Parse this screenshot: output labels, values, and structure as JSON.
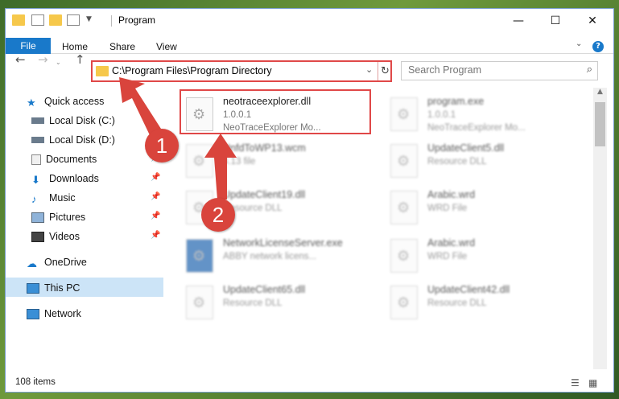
{
  "window": {
    "title": "Program"
  },
  "ribbon": {
    "file": "File",
    "home": "Home",
    "share": "Share",
    "view": "View",
    "help": "?"
  },
  "nav": {
    "back": "←",
    "forward": "→",
    "up": "↑"
  },
  "address": {
    "path": "C:\\Program Files\\Program Directory"
  },
  "search": {
    "placeholder": "Search Program"
  },
  "sidebar": {
    "items": [
      {
        "label": "Quick access"
      },
      {
        "label": "Local Disk (C:)"
      },
      {
        "label": "Local Disk (D:)"
      },
      {
        "label": "Documents"
      },
      {
        "label": "Downloads"
      },
      {
        "label": "Music"
      },
      {
        "label": "Pictures"
      },
      {
        "label": "Videos"
      },
      {
        "label": "OneDrive"
      },
      {
        "label": "This PC"
      },
      {
        "label": "Network"
      }
    ]
  },
  "files": [
    {
      "name": "neotraceexplorer.dll",
      "line1": "1.0.0.1",
      "line2": "NeoTraceExplorer Mo..."
    },
    {
      "name": "program.exe",
      "line1": "1.0.0.1",
      "line2": "NeoTraceExplorer Mo..."
    },
    {
      "name": "UnfdToWP13.wcm",
      "line1": "4.13 file",
      "line2": ""
    },
    {
      "name": "UpdateClient5.dll",
      "line1": "Resource DLL",
      "line2": ""
    },
    {
      "name": "UpdateClient19.dll",
      "line1": "Resource DLL",
      "line2": ""
    },
    {
      "name": "Arabic.wrd",
      "line1": "WRD File",
      "line2": ""
    },
    {
      "name": "NetworkLicenseServer.exe",
      "line1": "ABBY network licens...",
      "line2": ""
    },
    {
      "name": "Arabic.wrd",
      "line1": "WRD File",
      "line2": ""
    },
    {
      "name": "UpdateClient65.dll",
      "line1": "Resource DLL",
      "line2": ""
    },
    {
      "name": "UpdateClient42.dll",
      "line1": "Resource DLL",
      "line2": ""
    }
  ],
  "status": {
    "items": "108 items"
  },
  "annotations": {
    "step1": "1",
    "step2": "2"
  },
  "colors": {
    "accent": "#1979ca",
    "highlight": "#e04848",
    "arrow": "#d9443c"
  }
}
